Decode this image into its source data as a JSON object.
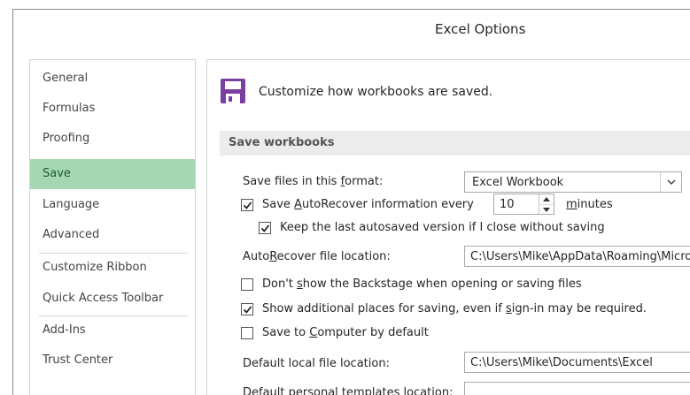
{
  "window": {
    "title": "Excel Options"
  },
  "sidebar": {
    "items": [
      {
        "label": "General"
      },
      {
        "label": "Formulas"
      },
      {
        "label": "Proofing"
      },
      {
        "label": "Save"
      },
      {
        "label": "Language"
      },
      {
        "label": "Advanced"
      },
      {
        "label": "Customize Ribbon"
      },
      {
        "label": "Quick Access Toolbar"
      },
      {
        "label": "Add-Ins"
      },
      {
        "label": "Trust Center"
      }
    ],
    "selected": "Save"
  },
  "main": {
    "header": {
      "icon": "floppy-disk-icon",
      "text": "Customize how workbooks are saved."
    },
    "section_title": "Save workbooks",
    "save_format": {
      "label_pre": "Save files in this ",
      "label_u": "f",
      "label_post": "ormat:",
      "value": "Excel Workbook"
    },
    "autorecover": {
      "checked": true,
      "label_pre": "Save ",
      "label_u": "A",
      "label_post": "utoRecover information every",
      "minutes_value": "10",
      "minutes_u": "m",
      "minutes_post": "inutes"
    },
    "keep_last": {
      "checked": true,
      "label": "Keep the last autosaved version if I close without saving"
    },
    "autorecover_location": {
      "label_pre": "Auto",
      "label_u": "R",
      "label_post": "ecover file location:",
      "value": "C:\\Users\\Mike\\AppData\\Roaming\\Microsoft\\Excel\\"
    },
    "dont_show_backstage": {
      "checked": false,
      "label_pre": "Don't ",
      "label_u": "s",
      "label_post": "how the Backstage when opening or saving files"
    },
    "show_additional": {
      "checked": true,
      "label_pre": "Show additional places for saving, even if ",
      "label_u": "s",
      "label_post": "ign-in may be required."
    },
    "save_to_computer": {
      "checked": false,
      "label_pre": "Save to ",
      "label_u": "C",
      "label_post": "omputer by default"
    },
    "default_local": {
      "label_pre": "Default local f",
      "label_u": "i",
      "label_post": "le location:",
      "value": "C:\\Users\\Mike\\Documents\\Excel"
    },
    "default_templates": {
      "label_pre": "Default personal ",
      "label_u": "t",
      "label_post": "emplates location:",
      "value": ""
    }
  },
  "colors": {
    "selected_nav_bg": "#a6d7b3",
    "selected_nav_text": "#1e5b31",
    "section_bar_bg": "#ececec",
    "floppy_purple": "#7a3fa0"
  }
}
